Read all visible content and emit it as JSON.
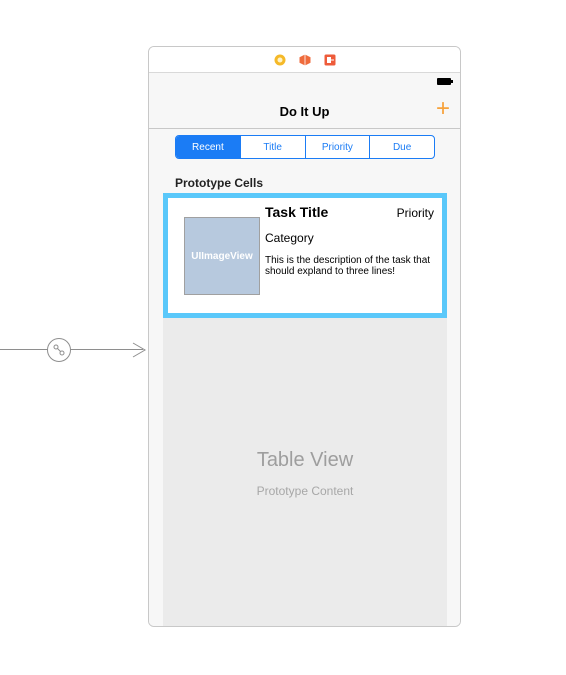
{
  "colors": {
    "accent": "#1b7cf5",
    "add_button": "#f7a23b",
    "cell_highlight": "#5ac8fa",
    "image_placeholder": "#b7c9de"
  },
  "dock": {
    "icons": [
      "view-controller-icon",
      "first-responder-icon",
      "exit-icon"
    ]
  },
  "nav": {
    "title": "Do It Up",
    "add_label": "+"
  },
  "segmented": {
    "items": [
      "Recent",
      "Title",
      "Priority",
      "Due"
    ],
    "selected": "Recent"
  },
  "section": {
    "header": "Prototype Cells"
  },
  "cell": {
    "image_label": "UIImageView",
    "title": "Task Title",
    "priority": "Priority",
    "category": "Category",
    "description": "This is the description of the task that should expland to three lines!"
  },
  "table_placeholder": {
    "title": "Table View",
    "subtitle": "Prototype Content"
  }
}
